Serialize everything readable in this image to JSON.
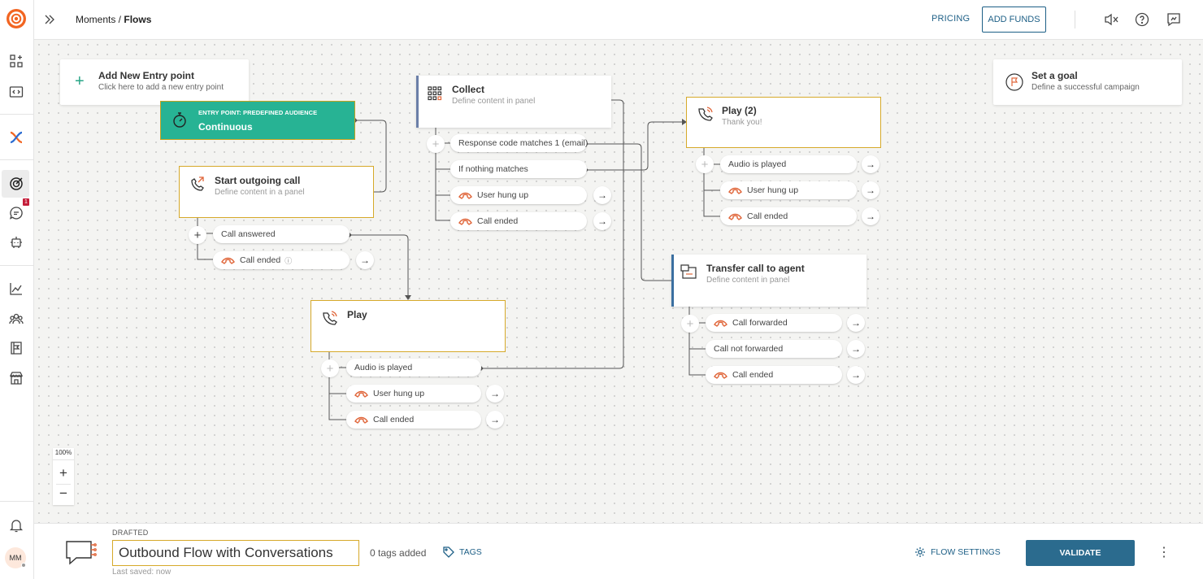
{
  "header": {
    "breadcrumb_parent": "Moments /",
    "breadcrumb_current": "Flows",
    "pricing_label": "PRICING",
    "add_funds_label": "ADD FUNDS"
  },
  "rail": {
    "notifications_badge": "1",
    "avatar_initials": "MM"
  },
  "canvas": {
    "add_entry": {
      "title": "Add New Entry point",
      "subtitle": "Click here to add a new entry point"
    },
    "goal": {
      "title": "Set a goal",
      "subtitle": "Define a successful campaign"
    },
    "entry_point": {
      "label": "ENTRY POINT: PREDEFINED AUDIENCE",
      "value": "Continuous"
    },
    "start_call": {
      "title": "Start outgoing call",
      "subtitle": "Define content in a panel",
      "outputs": [
        "Call answered",
        "Call ended"
      ]
    },
    "collect": {
      "title": "Collect",
      "subtitle": "Define content in panel",
      "outputs": [
        "Response code matches 1 (email)",
        "If nothing matches",
        "User hung up",
        "Call ended"
      ]
    },
    "play": {
      "title": "Play",
      "outputs": [
        "Audio is played",
        "User hung up",
        "Call ended"
      ]
    },
    "play2": {
      "title": "Play (2)",
      "subtitle": "Thank you!",
      "outputs": [
        "Audio is played",
        "User hung up",
        "Call ended"
      ]
    },
    "transfer": {
      "title": "Transfer call to agent",
      "subtitle": "Define content in panel",
      "outputs": [
        "Call forwarded",
        "Call not forwarded",
        "Call ended"
      ]
    },
    "zoom_level": "100%"
  },
  "footer": {
    "status": "DRAFTED",
    "flow_name": "Outbound Flow with Conversations",
    "last_saved": "Last saved: now",
    "tags_added": "0 tags added",
    "tags_label": "TAGS",
    "flow_settings_label": "FLOW SETTINGS",
    "validate_label": "VALIDATE"
  },
  "colors": {
    "accent": "#1d5f86",
    "entry_green": "#27b394",
    "node_border": "#d6a92a",
    "hangup_icon": "#e0663a",
    "logo": "#f26522"
  }
}
